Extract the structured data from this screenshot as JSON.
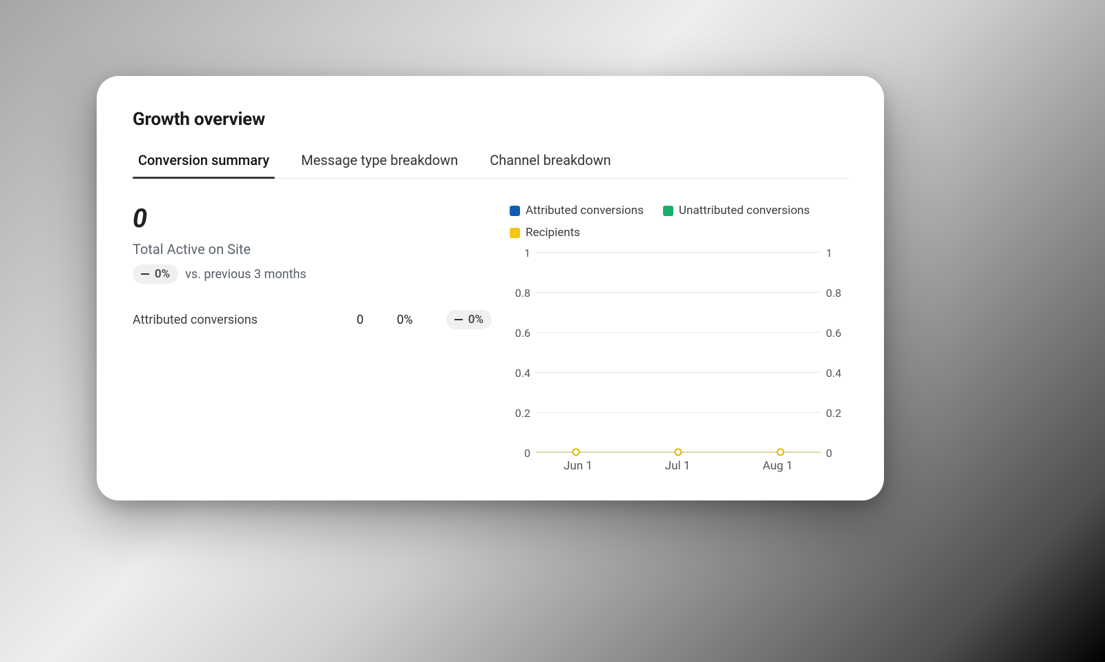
{
  "title": "Growth overview",
  "tabs": [
    {
      "label": "Conversion summary",
      "active": true
    },
    {
      "label": "Message type breakdown",
      "active": false
    },
    {
      "label": "Channel breakdown",
      "active": false
    }
  ],
  "summary": {
    "total_value": "0",
    "total_label": "Total Active on Site",
    "delta_badge": "0%",
    "compare_text": "vs. previous 3 months"
  },
  "rows": [
    {
      "label": "Attributed conversions",
      "value": "0",
      "percent": "0%",
      "delta_badge": "0%"
    }
  ],
  "legend": [
    {
      "name": "Attributed conversions",
      "color": "blue"
    },
    {
      "name": "Unattributed conversions",
      "color": "green"
    },
    {
      "name": "Recipients",
      "color": "yellow"
    }
  ],
  "chart_data": {
    "type": "line",
    "x": [
      "Jun 1",
      "Jul 1",
      "Aug 1"
    ],
    "series": [
      {
        "name": "Attributed conversions",
        "values": [
          0,
          0,
          0
        ]
      },
      {
        "name": "Unattributed conversions",
        "values": [
          0,
          0,
          0
        ]
      },
      {
        "name": "Recipients",
        "values": [
          0,
          0,
          0
        ]
      }
    ],
    "ylim_left": [
      0,
      1
    ],
    "yticks_left": [
      0,
      0.2,
      0.4,
      0.6,
      0.8,
      1
    ],
    "ylim_right": [
      0,
      1
    ],
    "yticks_right": [
      0,
      0.2,
      0.4,
      0.6,
      0.8,
      1
    ]
  }
}
